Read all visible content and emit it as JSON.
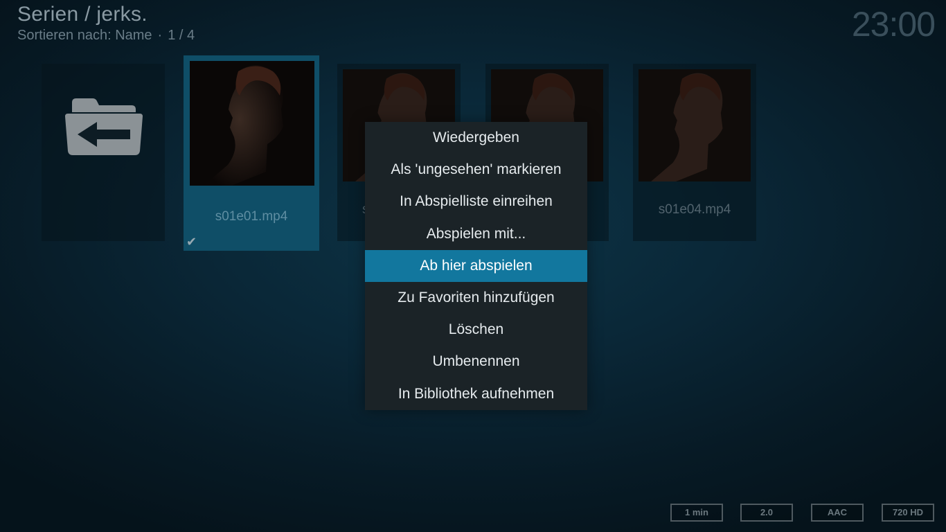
{
  "header": {
    "title": "Serien / jerks.",
    "sort_label": "Sortieren nach: Name",
    "separator": "·",
    "page_position": "1 / 4"
  },
  "clock": "23:00",
  "tiles": [
    {
      "type": "parent-folder",
      "label": ""
    },
    {
      "type": "video",
      "label": "s01e01.mp4",
      "watched": true,
      "selected": true
    },
    {
      "type": "video",
      "label": "s",
      "watched": false
    },
    {
      "type": "video",
      "label": "",
      "watched": false
    },
    {
      "type": "video",
      "label": "s01e04.mp4",
      "watched": false
    }
  ],
  "context_menu": {
    "items": [
      "Wiedergeben",
      "Als 'ungesehen' markieren",
      "In Abspielliste einreihen",
      "Abspielen mit...",
      "Ab hier abspielen",
      "Zu Favoriten hinzufügen",
      "Löschen",
      "Umbenennen",
      "In Bibliothek aufnehmen"
    ],
    "active_index": 4
  },
  "info_badges": [
    "1 min",
    "2.0",
    "AAC",
    "720 HD"
  ],
  "icons": {
    "parent_folder": "folder-back-icon",
    "watched": "checkmark-icon"
  },
  "colors": {
    "accent": "#12779e",
    "selected_tile": "#0f4e67",
    "menu_bg": "#1b2327"
  }
}
